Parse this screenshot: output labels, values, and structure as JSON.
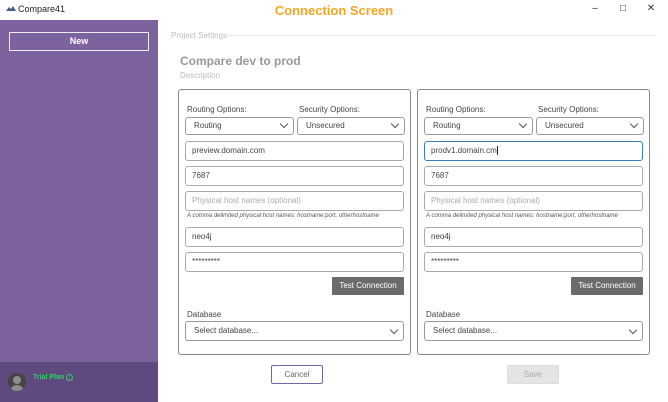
{
  "window": {
    "app_title": "Compare41",
    "center_title": "Connection Screen",
    "minimize": "–",
    "maximize": "□",
    "close": "✕"
  },
  "sidebar": {
    "new_label": "New",
    "plan_label": "Trial Plan",
    "plan_icon": "info-icon"
  },
  "header": {
    "settings_label": "Project Settings",
    "project_name": "Compare dev to prod",
    "description_placeholder": "Description"
  },
  "panels": [
    {
      "routing_label": "Routing Options:",
      "security_label": "Security Options:",
      "routing_value": "Routing",
      "security_value": "Unsecured",
      "host": "preview.domain.com",
      "port": "7687",
      "physical_placeholder": "Physical host names (optional)",
      "physical_hint": "A comma delimited physical host names: hostname:port, otherhostname",
      "user": "neo4j",
      "password": "*********",
      "test_label": "Test Connection",
      "database_label": "Database",
      "database_value": "Select database..."
    },
    {
      "routing_label": "Routing Options:",
      "security_label": "Security Options:",
      "routing_value": "Routing",
      "security_value": "Unsecured",
      "host": "prodv1.domain.cm",
      "port": "7687",
      "physical_placeholder": "Physical host names (optional)",
      "physical_hint": "A comma delimited physical host names: hostname:port, otherhostname",
      "user": "neo4j",
      "password": "*********",
      "test_label": "Test Connection",
      "database_label": "Database",
      "database_value": "Select database..."
    }
  ],
  "footer": {
    "cancel_label": "Cancel",
    "save_label": "Save"
  },
  "colors": {
    "accent": "#7d62a0",
    "title": "#f5a623",
    "plan": "#3ac96a"
  }
}
